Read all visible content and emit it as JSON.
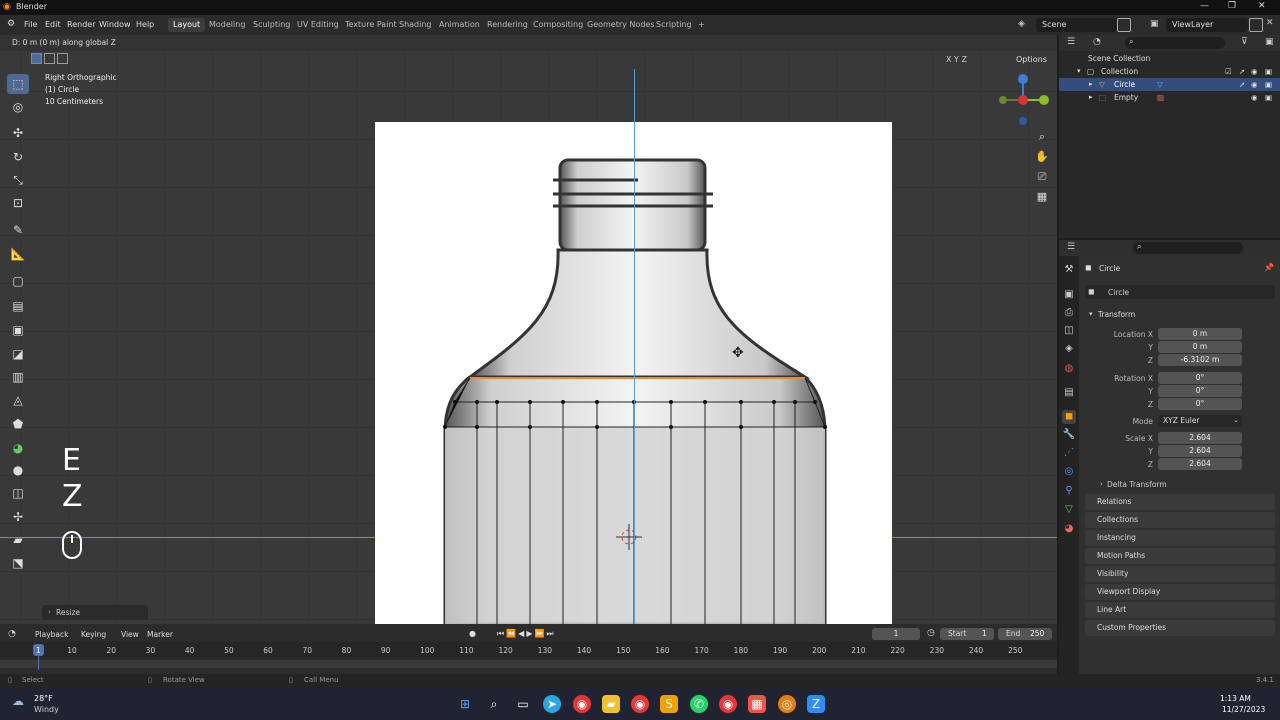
{
  "window": {
    "title": "Blender"
  },
  "menubar": {
    "menus": [
      "File",
      "Edit",
      "Render",
      "Window",
      "Help"
    ],
    "workspaces": [
      "Layout",
      "Modeling",
      "Sculpting",
      "UV Editing",
      "Texture Paint",
      "Shading",
      "Animation",
      "Rendering",
      "Compositing",
      "Geometry Nodes",
      "Scripting"
    ],
    "active_workspace": "Layout",
    "add_workspace": "+",
    "scene": "Scene",
    "view_layer": "ViewLayer"
  },
  "viewport": {
    "header_status": "D: 0 m (0 m) along global Z",
    "view_name": "Right Orthographic",
    "object_label": "(1) Circle",
    "scale_label": "10 Centimeters",
    "axis_buttons": "X Y Z",
    "options_label": "Options",
    "last_operator": "Resize",
    "key_hints": [
      "E",
      "Z"
    ]
  },
  "outliner": {
    "root": "Scene Collection",
    "collection": "Collection",
    "items": [
      "Circle",
      "Empty"
    ]
  },
  "properties": {
    "object_name": "Circle",
    "datablock_name": "Circle",
    "panel_title": "Transform",
    "location": {
      "label": "Location X",
      "x": "0 m",
      "y": "0 m",
      "z": "-6.3102 m"
    },
    "rotation": {
      "label": "Rotation X",
      "x": "0°",
      "y": "0°",
      "z": "0°"
    },
    "mode_label": "Mode",
    "mode_value": "XYZ Euler",
    "scale": {
      "label": "Scale X",
      "x": "2.604",
      "y": "2.604",
      "z": "2.604"
    },
    "axis_y": "Y",
    "axis_z": "Z",
    "sections": [
      "Delta Transform",
      "Relations",
      "Collections",
      "Instancing",
      "Motion Paths",
      "Visibility",
      "Viewport Display",
      "Line Art",
      "Custom Properties"
    ]
  },
  "timeline": {
    "menus": [
      "Playback",
      "Keying",
      "View",
      "Marker"
    ],
    "current_frame": "1",
    "start_label": "Start",
    "start": "1",
    "end_label": "End",
    "end": "250",
    "ticks": [
      "1",
      "10",
      "20",
      "30",
      "40",
      "50",
      "60",
      "70",
      "80",
      "90",
      "100",
      "110",
      "120",
      "130",
      "140",
      "150",
      "160",
      "170",
      "180",
      "190",
      "200",
      "210",
      "220",
      "230",
      "240",
      "250"
    ]
  },
  "statusbar": {
    "select": "Select",
    "rotate": "Rotate View",
    "call_menu": "Call Menu",
    "version": "3.4.1"
  },
  "taskbar": {
    "weather_temp": "28°F",
    "weather_desc": "Windy",
    "time": "1:13 AM",
    "date": "11/27/2023"
  }
}
